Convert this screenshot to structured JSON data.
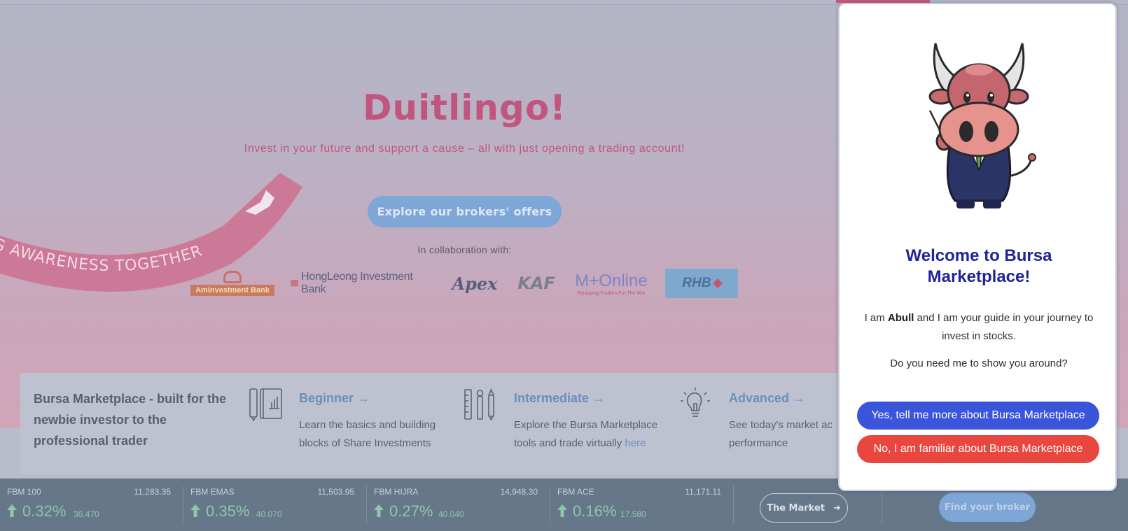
{
  "hero": {
    "title": "Duitlingo!",
    "subtitle": "Invest in your future and support a cause – all with just opening a trading account!",
    "explore_button": "Explore our brokers' offers",
    "collab_label": "In collaboration with:",
    "ribbon_text": "NG AWARENESS TOGETHER"
  },
  "brokers": {
    "am": "AmInvestment Bank",
    "hongleong": "HongLeong Investment Bank",
    "apex": "Apex",
    "kaf": "KAF",
    "mplus_main": "M+Online",
    "mplus_tag": "Equipping Traders For The Win",
    "rhb": "RHB"
  },
  "intro": {
    "tagline": "Bursa Marketplace - built for the newbie investor to the professional trader",
    "cards": [
      {
        "title": "Beginner →",
        "desc": "Learn the basics and building blocks of Share Investments"
      },
      {
        "title": "Intermediate →",
        "desc": "Explore the Bursa Marketplace tools and trade virtually ",
        "link": "here"
      },
      {
        "title": "Advanced →",
        "desc": "See today's market ac performance"
      }
    ]
  },
  "ticker": [
    {
      "name": "FBM 100",
      "value": "11,283.35",
      "pct": "0.32%",
      "change": "36.470"
    },
    {
      "name": "FBM EMAS",
      "value": "11,503.95",
      "pct": "0.35%",
      "change": "40.070"
    },
    {
      "name": "FBM HIJRA",
      "value": "14,948.30",
      "pct": "0.27%",
      "change": "40.040"
    },
    {
      "name": "FBM ACE",
      "value": "11,171.11",
      "pct": "0.16%",
      "change": "17.580"
    }
  ],
  "buttons": {
    "the_market": "The Market",
    "find_broker": "Find your broker"
  },
  "modal": {
    "title": "Welcome to Bursa Marketplace!",
    "intro_prefix": "I am ",
    "guide_name": "Abull",
    "intro_suffix": " and I am your guide in your journey to invest in stocks.",
    "question": "Do you need me to show you around?",
    "yes_button": "Yes, tell me more about Bursa Marketplace",
    "no_button": "No, I am familiar about Bursa Marketplace"
  },
  "colors": {
    "brand_pink": "#c2557d",
    "modal_title": "#1f259a",
    "yes_button": "#3a55da",
    "no_button": "#e9463f",
    "ticker_up": "#8fc7a8"
  }
}
